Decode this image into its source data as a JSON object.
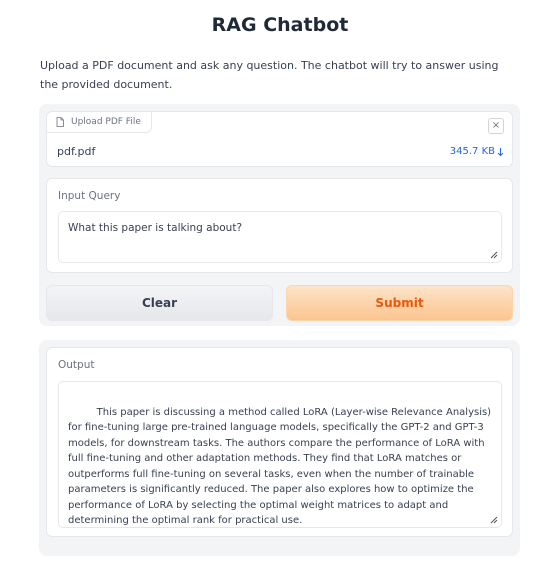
{
  "app": {
    "title": "RAG Chatbot",
    "description": "Upload a PDF document and ask any question. The chatbot will try to answer using the provided document."
  },
  "file_upload": {
    "label": "Upload PDF File",
    "label_icon": "file-icon",
    "file_name": "pdf.pdf",
    "file_size": "345.7 KB",
    "download_icon": "download-arrow-icon",
    "close_icon": "close-icon",
    "close_glyph": "×"
  },
  "query": {
    "label": "Input Query",
    "value": "What this paper is talking about?"
  },
  "buttons": {
    "clear": "Clear",
    "submit": "Submit"
  },
  "output": {
    "label": "Output",
    "value": " This paper is discussing a method called LoRA (Layer-wise Relevance Analysis) for fine-tuning large pre-trained language models, specifically the GPT-2 and GPT-3 models, for downstream tasks. The authors compare the performance of LoRA with full fine-tuning and other adaptation methods. They find that LoRA matches or outperforms full fine-tuning on several tasks, even when the number of trainable parameters is significantly reduced. The paper also explores how to optimize the performance of LoRA by selecting the optimal weight matrices to adapt and determining the optimal rank for practical use."
  },
  "colors": {
    "accent": "#ea580c",
    "link": "#2563eb",
    "panel_bg": "#f3f4f6"
  }
}
